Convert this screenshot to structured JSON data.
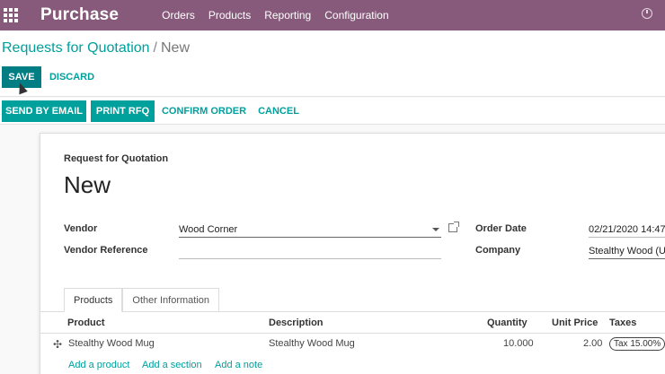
{
  "navbar": {
    "app_name": "Purchase",
    "menu": [
      "Orders",
      "Products",
      "Reporting",
      "Configuration"
    ]
  },
  "breadcrumb": {
    "parent": "Requests for Quotation",
    "separator": "/",
    "current": "New"
  },
  "buttons": {
    "save": "SAVE",
    "discard": "DISCARD"
  },
  "statusbar": {
    "send_by_email": "SEND BY EMAIL",
    "print_rfq": "PRINT RFQ",
    "confirm_order": "CONFIRM ORDER",
    "cancel": "CANCEL"
  },
  "form": {
    "label": "Request for Quotation",
    "title": "New",
    "vendor_label": "Vendor",
    "vendor_value": "Wood Corner",
    "vendor_reference_label": "Vendor Reference",
    "vendor_reference_value": "",
    "order_date_label": "Order Date",
    "order_date_value": "02/21/2020 14:47",
    "company_label": "Company",
    "company_value": "Stealthy Wood (U"
  },
  "tabs": [
    "Products",
    "Other Information"
  ],
  "table": {
    "headers": {
      "product": "Product",
      "description": "Description",
      "quantity": "Quantity",
      "unit_price": "Unit Price",
      "taxes": "Taxes"
    },
    "rows": [
      {
        "product": "Stealthy Wood Mug",
        "description": "Stealthy Wood Mug",
        "quantity": "10.000",
        "unit_price": "2.00",
        "taxes": "Tax 15.00%"
      }
    ],
    "add_product": "Add a product",
    "add_section": "Add a section",
    "add_note": "Add a note"
  },
  "colors": {
    "navbar": "#875a7b",
    "primary": "#00a09d",
    "save": "#017e84"
  }
}
